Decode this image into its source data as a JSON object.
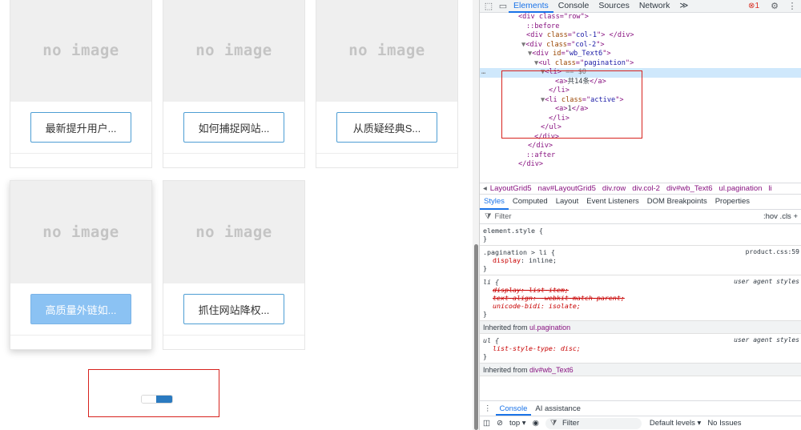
{
  "page": {
    "cards": [
      {
        "thumb": "no image",
        "button": "最新提升用户..."
      },
      {
        "thumb": "no image",
        "button": "如何捕捉网站..."
      },
      {
        "thumb": "no image",
        "button": "从质疑经典S..."
      },
      {
        "thumb": "no image",
        "button": "高质量外链如..."
      },
      {
        "thumb": "no image",
        "button": "抓住网站降权..."
      }
    ]
  },
  "devtools": {
    "tabs": [
      "Elements",
      "Console",
      "Sources",
      "Network"
    ],
    "more_tabs": "≫",
    "error_count": "1",
    "tree": {
      "l0": "<div class=\"row\">",
      "l1": "::before",
      "l2_tag": "div",
      "l2_attr": "class",
      "l2_val": "col-1",
      "l3_tag": "div",
      "l3_attr": "class",
      "l3_val": "col-2",
      "l4_tag": "div",
      "l4_attr": "id",
      "l4_val": "wb_Text6",
      "l5_tag": "ul",
      "l5_attr": "class",
      "l5_val": "pagination",
      "l6_tag": "li",
      "l6_eq": "== $0",
      "l7_text": "共14条",
      "l8": "</li>",
      "l9_tag": "li",
      "l9_attr": "class",
      "l9_val": "active",
      "l10_text": "1",
      "l11": "</li>",
      "l12": "</ul>",
      "l13": "</div>",
      "l14": "</div>",
      "l15": "::after",
      "l16": "</div>"
    },
    "breadcrumb": [
      "LayoutGrid5",
      "nav#LayoutGrid5",
      "div.row",
      "div.col-2",
      "div#wb_Text6",
      "ul.pagination",
      "li"
    ],
    "style_tabs": [
      "Styles",
      "Computed",
      "Layout",
      "Event Listeners",
      "DOM Breakpoints",
      "Properties"
    ],
    "filter_placeholder": "Filter",
    "filter_right": ":hov  .cls  +",
    "rules": {
      "element_style": "element.style {",
      "r1_selector": ".pagination > li {",
      "r1_prop": "display",
      "r1_val": "inline;",
      "r1_src": "product.css:59",
      "r2_selector": "li {",
      "r2_src": "user agent styles",
      "r2_p1": "display: list-item;",
      "r2_p2": "text-align: -webkit-match-parent;",
      "r2_p3": "unicode-bidi: isolate;",
      "inh1_label": "Inherited from",
      "inh1_sel": "ul.pagination",
      "r3_selector": "ul {",
      "r3_src": "user agent styles",
      "r3_p1": "list-style-type: disc;",
      "inh2_label": "Inherited from",
      "inh2_sel": "div#wb_Text6",
      "close": "}"
    },
    "console": {
      "tabs": [
        "Console",
        "AI assistance"
      ],
      "context": "top ▾",
      "filter": "Filter",
      "levels": "Default levels ▾",
      "issues": "No Issues"
    }
  }
}
